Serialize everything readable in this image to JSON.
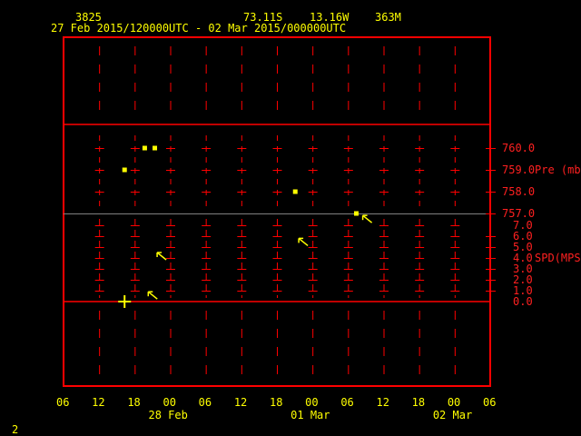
{
  "header": {
    "station": "3825",
    "lat": "73.11S",
    "lon": "13.16W",
    "elev": "363M",
    "range": "27 Feb 2015/120000UTC - 02 Mar 2015/000000UTC"
  },
  "footer": {
    "page": "2"
  },
  "colors": {
    "axis": "#ff0000",
    "data": "#ffff00",
    "bg": "#000000"
  },
  "chart_data": {
    "type": "scatter",
    "x_unit": "hours since 27 Feb 06 UTC",
    "xlim": [
      0,
      72
    ],
    "x_ticks": [
      0,
      6,
      12,
      18,
      24,
      30,
      36,
      42,
      48,
      54,
      60,
      66,
      72
    ],
    "x_tick_labels": [
      "06",
      "12",
      "18",
      "00",
      "06",
      "12",
      "18",
      "00",
      "06",
      "12",
      "18",
      "00",
      "06"
    ],
    "date_labels": [
      {
        "hour": 18,
        "label": "28 Feb"
      },
      {
        "hour": 42,
        "label": "01 Mar"
      },
      {
        "hour": 66,
        "label": "02 Mar"
      }
    ],
    "pressure": {
      "label": "Pre (mb)",
      "ylim": [
        757,
        760
      ],
      "ticks": [
        "760.0",
        "759.0",
        "758.0",
        "757.0"
      ],
      "points": [
        [
          10.3,
          759.0
        ],
        [
          13.7,
          760.0
        ],
        [
          15.4,
          760.0
        ],
        [
          39.1,
          758.0
        ],
        [
          49.4,
          757.0
        ]
      ]
    },
    "speed": {
      "label": "SPD(MPS)",
      "ylim": [
        0,
        7
      ],
      "ticks": [
        "7.0",
        "6.0",
        "5.0",
        "4.0",
        "3.0",
        "2.0",
        "1.0",
        "0.0"
      ],
      "calm_points": [
        [
          10.3,
          0
        ]
      ],
      "wind_points": [
        [
          12.3,
          0.9
        ],
        [
          13.8,
          4.5
        ],
        [
          37.7,
          5.8
        ],
        [
          48.5,
          7.9
        ]
      ]
    }
  }
}
